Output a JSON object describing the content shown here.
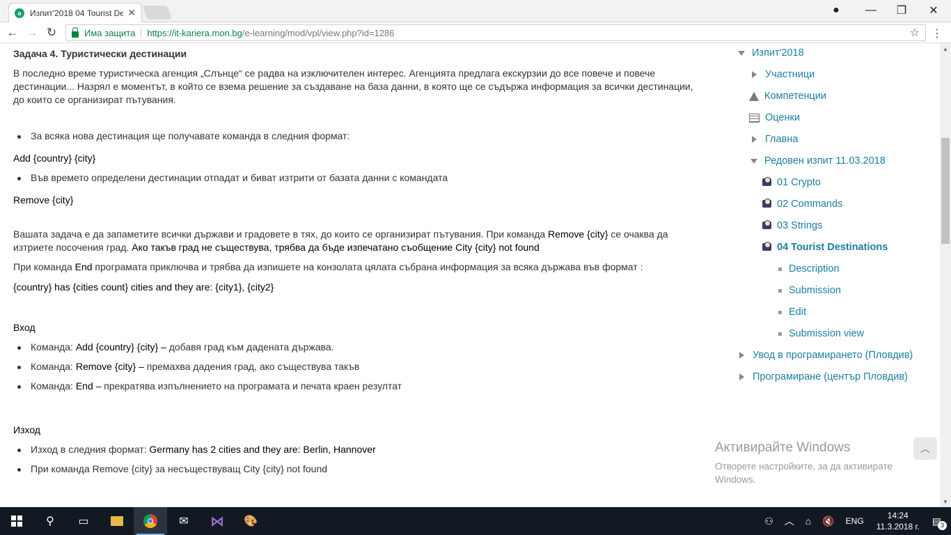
{
  "browser": {
    "tab_title": "Изпит'2018 04 Tourist De",
    "tab_favicon": "a",
    "secure_label": "Има защита",
    "url_scheme_host": "https://it-kariera.mon.bg",
    "url_path": "/e-learning/mod/vpl/view.php?id=1286"
  },
  "content": {
    "heading": "Задача 4. Туристически дестинации",
    "intro": "В последно време туристическа агенция „Слънце“ се радва на изключителен интерес. Агенцията предлага екскурзии до все повече и повече дестинации... Назрял е моментът, в който се взема решение за създаване на база данни, в която ще се съдържа информация за всички дестинации, до които се организират пътувания.",
    "bullet_add": "За всяка нова дестинация ще получавате команда в следния формат:",
    "add_format": "Add {country} {city}",
    "bullet_remove": "Във времето определени дестинации отпадат и биват изтрити от базата данни с командата",
    "remove_format": "Remove {city}",
    "task_part1": "Вашата задача е да запаметите всички държави и градовете в тях, до които се организират пътувания. При команда ",
    "task_remove": "Remove {city}",
    "task_part2": " се очаква да изтриете посочения град. ",
    "task_bold": "Ако такъв град не съществува, трябва да бъде изпечатано съобщение City {city} not found",
    "end_part1": "При команда ",
    "end_word": "End",
    "end_part2": " програмата приключва и трябва да изпишете на конзолата цялата събрана информация за всяка държава във формат :",
    "output_format": "{country} has {cities count} cities and they are: {city1}, {city2}",
    "input_heading": "Вход",
    "input_items": [
      {
        "prefix": "Команда: ",
        "cmd": "Add {country} {city} –",
        "desc": " добавя град към дадената държава."
      },
      {
        "prefix": "Команда: ",
        "cmd": "Remove {city} –",
        "desc": " премахва дадения град, ако съществува такъв"
      },
      {
        "prefix": "Команда: ",
        "cmd": "End –",
        "desc": " прекратява изпълнението на програмата и печата краен резултат"
      }
    ],
    "output_heading": "Изход",
    "output_item_prefix": "Изход в следния формат: ",
    "output_item_example": "Germany has 2 cities and they are: Berlin, Hannover",
    "cut_line": "При команда Remove {city} за несъществуващ City {city} not found"
  },
  "sidebar": {
    "course": "Изпит'2018",
    "participants": "Участници",
    "competencies": "Компетенции",
    "grades": "Оценки",
    "home": "Главна",
    "section": "Редовен изпит 11.03.2018",
    "activities": [
      "01 Crypto",
      "02 Commands",
      "03 Strings",
      "04 Tourist Destinations"
    ],
    "sub_items": [
      "Description",
      "Submission",
      "Edit",
      "Submission view"
    ],
    "other_courses": [
      "Увод в програмирането (Пловдив)",
      "Програмиране (център Пловдив)"
    ]
  },
  "watermark": {
    "title": "Активирайте Windows",
    "subtitle": "Отворете настройките, за да активирате Windows."
  },
  "taskbar": {
    "language": "ENG",
    "time": "14:24",
    "date": "11.3.2018 г.",
    "notification_count": "3"
  }
}
